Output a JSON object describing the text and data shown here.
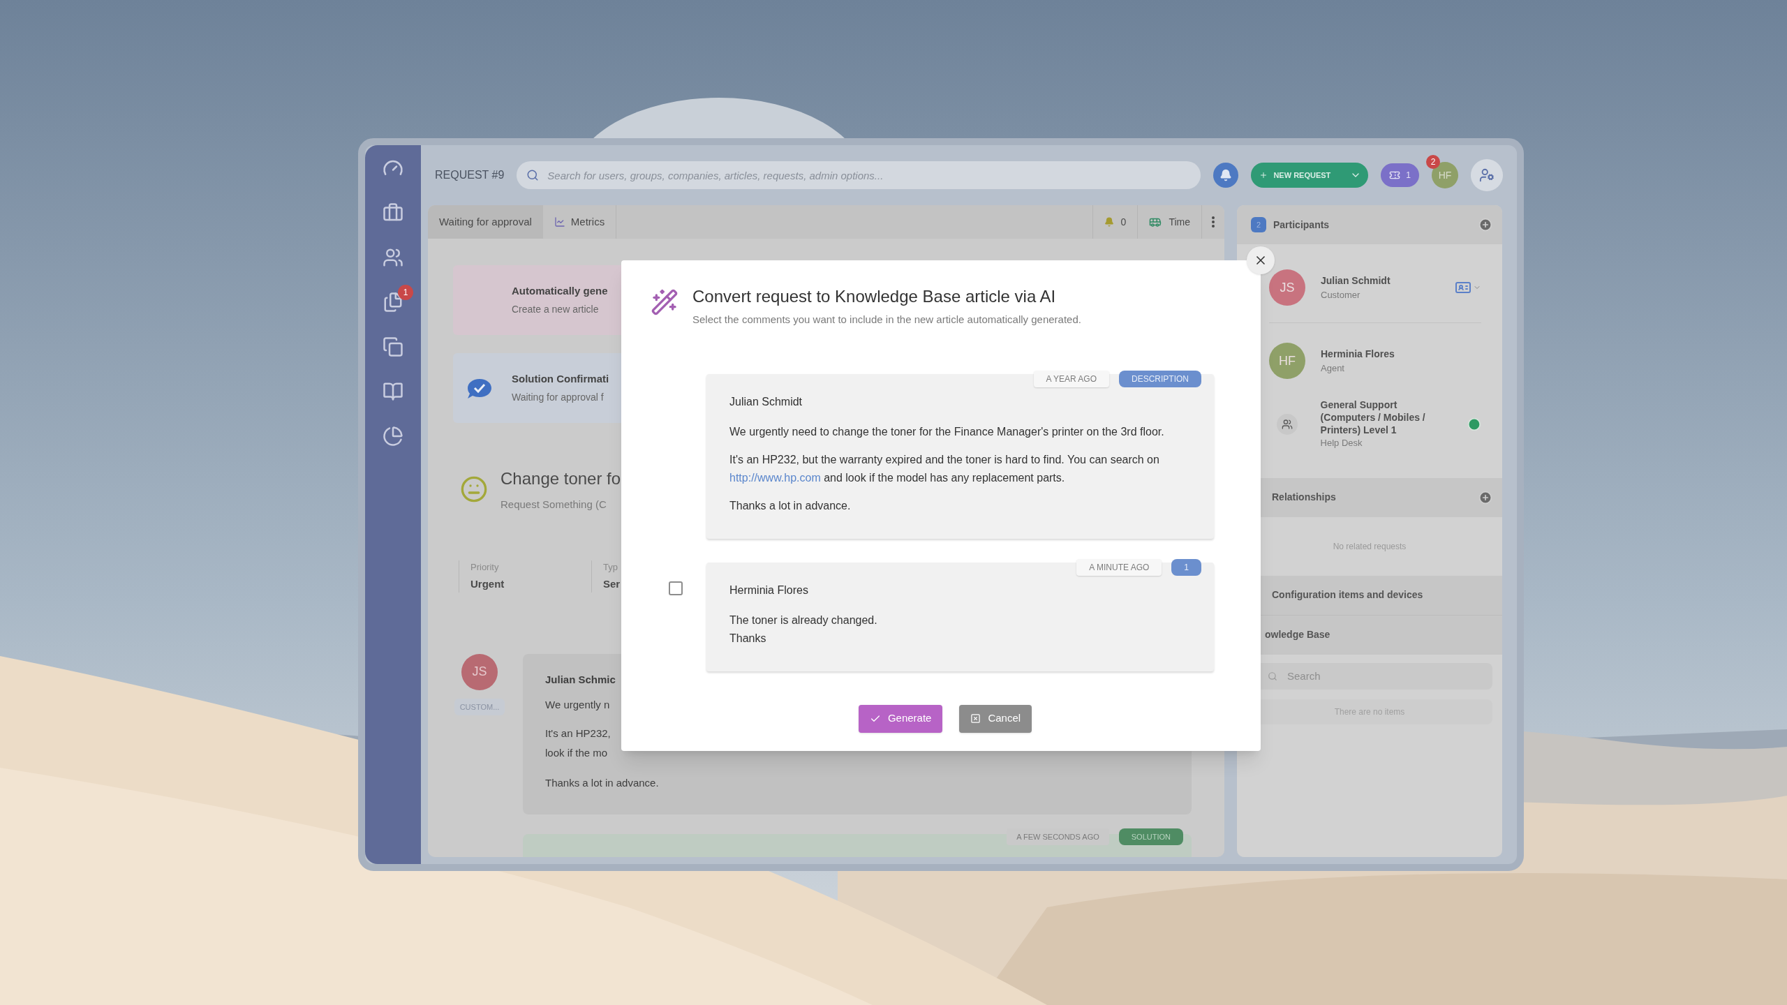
{
  "app": {
    "sidebar": {
      "badge": "1"
    },
    "header": {
      "title": "REQUEST #9",
      "search_placeholder": "Search for users, groups, companies, articles, requests, admin options...",
      "new_request": "NEW REQUEST",
      "chat_count": "1",
      "avatar_initials": "HF",
      "avatar_badge": "2"
    },
    "tabs": [
      {
        "label": "Waiting for approval",
        "selected": true
      },
      {
        "label": "Metrics",
        "selected": false
      }
    ],
    "alerts_count": "0",
    "time_label": "Time",
    "cards": [
      {
        "kind": "ai",
        "title": "Automatically gene",
        "subtitle": "Create a new article"
      },
      {
        "kind": "solution",
        "title": "Solution Confirmati",
        "subtitle": "Waiting for approval f"
      }
    ],
    "request": {
      "title": "Change toner fo",
      "subtitle": "Request Something (C",
      "fields": [
        {
          "label": "Priority",
          "value": "Urgent"
        },
        {
          "label": "Typ",
          "value": "Ser"
        }
      ]
    },
    "comment": {
      "initials": "JS",
      "role": "CUSTOM...",
      "author": "Julian Schmic",
      "lines": [
        "We urgently n",
        "It's an HP232,",
        "look if the mo",
        "Thanks a lot in advance."
      ]
    },
    "solution": {
      "time": "A FEW SECONDS AGO",
      "tag": "SOLUTION"
    },
    "participants": {
      "count": "2",
      "title": "Participants",
      "people": [
        {
          "initials": "JS",
          "name": "Julian Schmidt",
          "role": "Customer",
          "color": "#c8737f"
        },
        {
          "initials": "HF",
          "name": "Herminia Flores",
          "role": "Agent",
          "color": "#8fa068"
        }
      ],
      "group": {
        "name": "General Support (Computers / Mobiles / Printers) Level 1",
        "role": "Help Desk"
      }
    },
    "relationships": {
      "title": "Relationships",
      "empty": "No related requests"
    },
    "config_title": "Configuration items and devices",
    "knowledge": {
      "title": "owledge Base",
      "search_placeholder": "Search",
      "empty": "There are no items"
    }
  },
  "modal": {
    "title": "Convert request to Knowledge Base article via AI",
    "subtitle": "Select the comments you want to include in the new article automatically generated.",
    "comments": [
      {
        "kind": "description",
        "author": "Julian Schmidt",
        "time": "A YEAR AGO",
        "tag": "DESCRIPTION",
        "paragraphs": [
          {
            "text": "We urgently need to change the toner for the Finance Manager's printer on the 3rd floor."
          },
          {
            "text": "It's an HP232, but the warranty expired and the toner is hard to find. You can search on ",
            "link": "http://www.hp.com",
            "after": " and look if the model has any replacement parts."
          },
          {
            "text": "Thanks a lot in advance."
          }
        ]
      },
      {
        "kind": "comment",
        "checked": false,
        "author": "Herminia Flores",
        "time": "A MINUTE AGO",
        "tag": "1",
        "paragraphs": [
          {
            "lines": [
              "The toner is already changed.",
              "Thanks"
            ]
          }
        ]
      }
    ],
    "generate": "Generate",
    "cancel": "Cancel"
  }
}
